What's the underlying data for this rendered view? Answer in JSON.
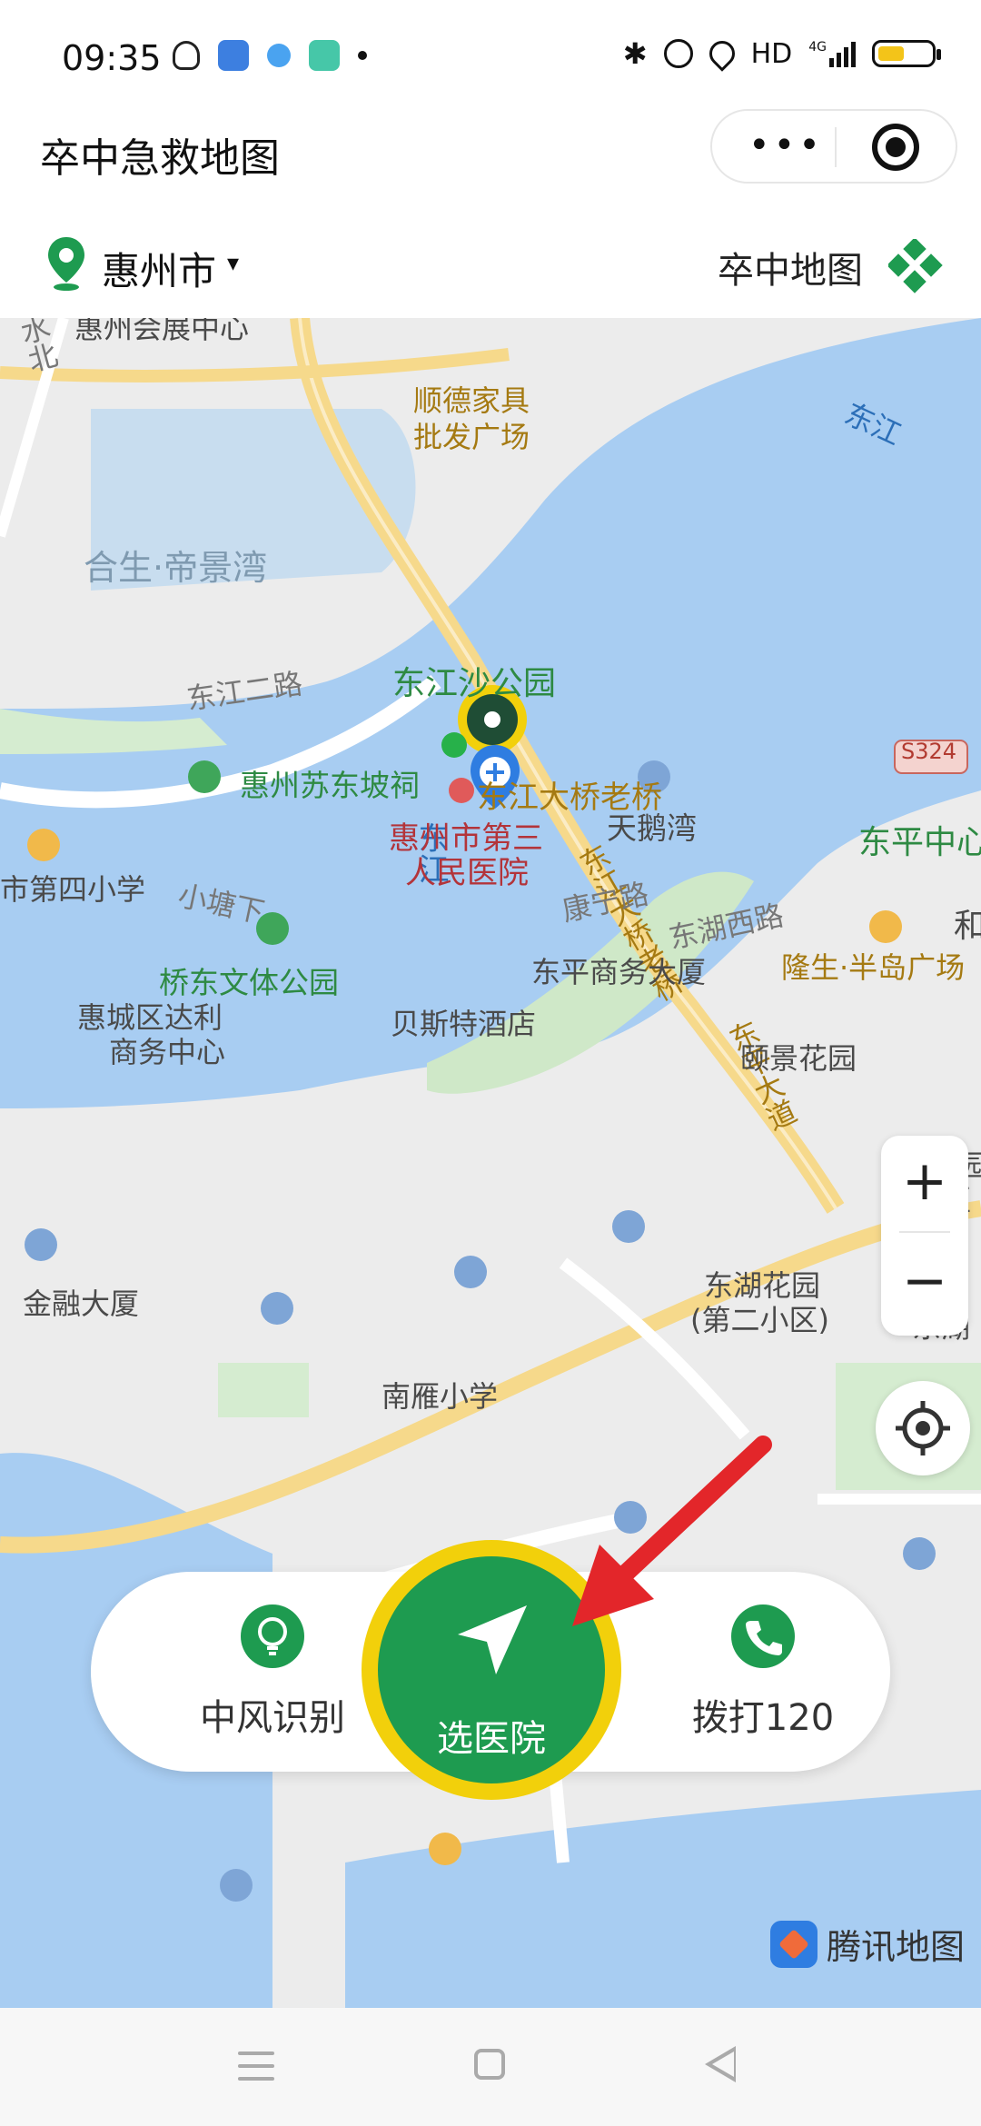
{
  "status_bar": {
    "time": "09:35",
    "network": "HD",
    "signal_label": "4G"
  },
  "title_bar": {
    "title": "卒中急救地图",
    "more_label": "•••"
  },
  "location_bar": {
    "city": "惠州市",
    "caret": "▾",
    "brand": "卒中地图"
  },
  "map": {
    "labels": {
      "expo": "惠州会展中心",
      "shunde_1": "顺德家具",
      "shunde_2": "批发广场",
      "dongjiang_ne": "东江",
      "shuibei": "水北",
      "hesheng": "合生·帝景湾",
      "dongjiang_road": "东江二路",
      "old_bridge": "东江大桥老桥",
      "dongjiang_river": "东江",
      "bridge_road": "东江大桥老桥",
      "dongping_ave": "东平大道",
      "park": "东江沙公园",
      "sudongpo": "惠州苏东坡祠",
      "tiane": "天鹅湾",
      "hospital_1": "惠州市第三",
      "hospital_2": "人民医院",
      "school4": "市第四小学",
      "xiaotang": "小塘下",
      "kangning": "康宁路",
      "donghu_w": "东湖西路",
      "dongping_c": "东平中心",
      "qiaodong": "桥东文体公园",
      "dongping_biz": "东平商务大厦",
      "longsheng": "隆生·半岛广场",
      "dali_1": "惠城区达利",
      "dali_2": "商务中心",
      "best": "贝斯特酒店",
      "yijing": "颐景花园",
      "jinrong": "金融大厦",
      "donghu_g1": "东湖花园",
      "donghu_g2": "(第二小区)",
      "donghu_e": "东湖",
      "nanyan": "南雁小学",
      "huayuan_1": "湖花园",
      "huayuan_2": "小区",
      "he": "和",
      "road_badge": "S324"
    },
    "zoom_in": "+",
    "zoom_out": "−",
    "provider": "腾讯地图"
  },
  "actions": {
    "stroke_id": "中风识别",
    "choose_hospital": "选医院",
    "call": "拨打120"
  },
  "colors": {
    "accent_green": "#1e9b50",
    "ring_yellow": "#f2d00b",
    "water": "#a8cdf2",
    "arrow_red": "#e3262a"
  }
}
